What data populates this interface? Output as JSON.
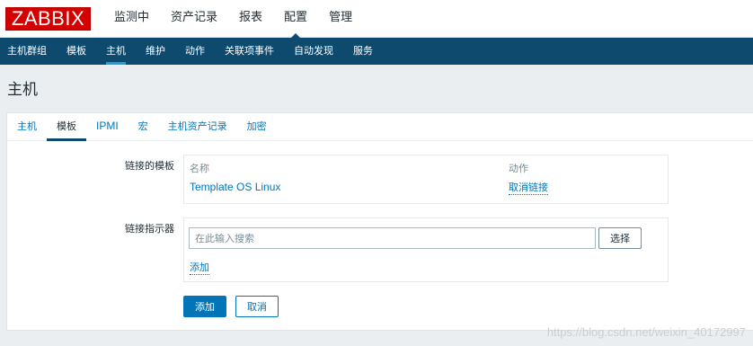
{
  "app": {
    "logo": "ZABBIX"
  },
  "topnav": [
    {
      "label": "监测中"
    },
    {
      "label": "资产记录"
    },
    {
      "label": "报表"
    },
    {
      "label": "配置"
    },
    {
      "label": "管理"
    }
  ],
  "subnav": [
    {
      "label": "主机群组"
    },
    {
      "label": "模板"
    },
    {
      "label": "主机"
    },
    {
      "label": "维护"
    },
    {
      "label": "动作"
    },
    {
      "label": "关联项事件"
    },
    {
      "label": "自动发现"
    },
    {
      "label": "服务"
    }
  ],
  "page": {
    "title": "主机"
  },
  "tabs": [
    {
      "label": "主机"
    },
    {
      "label": "模板"
    },
    {
      "label": "IPMI"
    },
    {
      "label": "宏"
    },
    {
      "label": "主机资产记录"
    },
    {
      "label": "加密"
    }
  ],
  "form": {
    "linked_templates": {
      "label": "链接的模板",
      "col_name": "名称",
      "col_action": "动作",
      "rows": [
        {
          "name": "Template OS Linux",
          "action": "取消链接"
        }
      ]
    },
    "link_indicator": {
      "label": "链接指示器",
      "search_placeholder": "在此输入搜索",
      "select_button": "选择",
      "add_link": "添加"
    },
    "submit": "添加",
    "cancel": "取消"
  },
  "watermark": "https://blog.csdn.net/weixin_40172997"
}
